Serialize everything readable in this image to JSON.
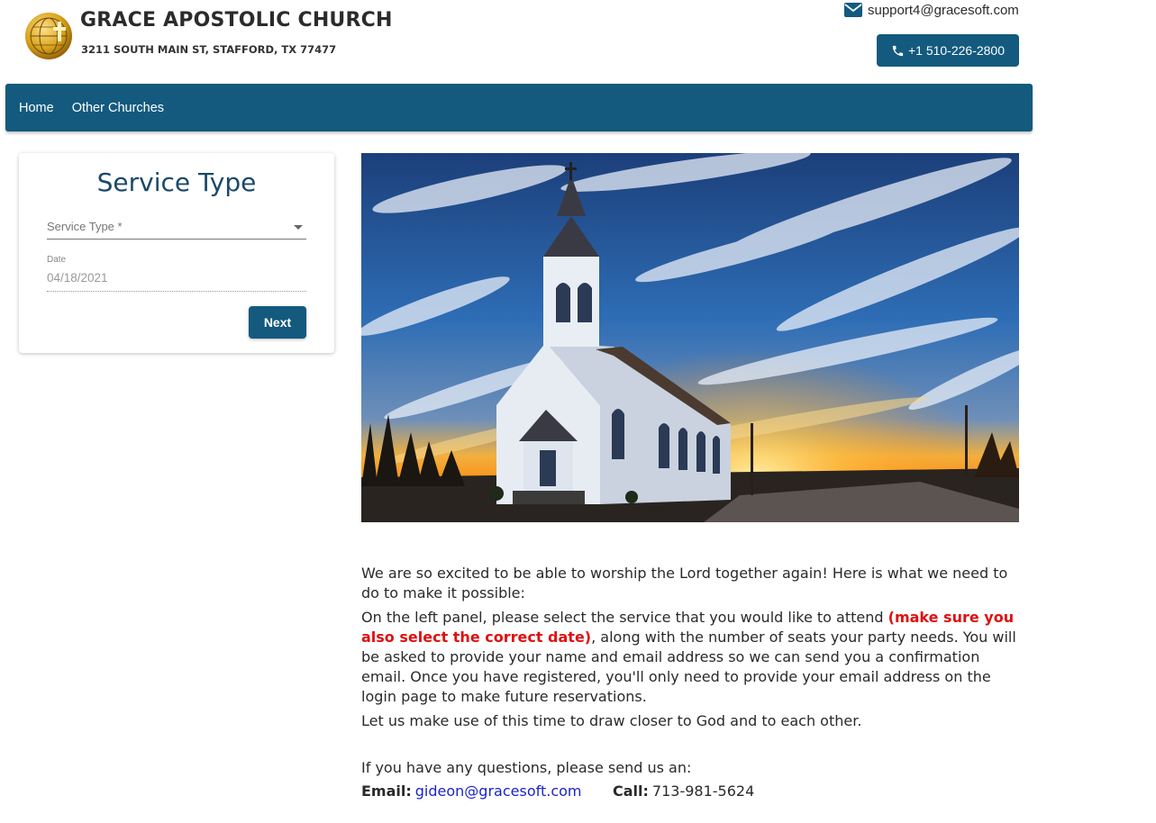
{
  "header": {
    "church_name": "GRACE APOSTOLIC CHURCH",
    "address": "3211 SOUTH MAIN ST, STAFFORD, TX 77477",
    "support_email": "support4@gracesoft.com",
    "phone_button": "+1 510-226-2800",
    "icons": {
      "logo": "globe-cross-logo",
      "email": "mail-icon",
      "phone": "phone-icon"
    }
  },
  "nav": {
    "items": [
      {
        "label": "Home"
      },
      {
        "label": "Other Churches"
      }
    ]
  },
  "service_card": {
    "title": "Service Type",
    "select_label": "Service Type *",
    "date_label": "Date",
    "date_value": "04/18/2021",
    "next_button": "Next"
  },
  "content": {
    "intro": "We are so excited to be able to worship the Lord together again! Here is what we need to do to make it possible:",
    "instructions_pre": "On the left panel, please select the service that you would like to attend ",
    "instructions_highlight": "(make sure you also select the correct date)",
    "instructions_post": ", along with the number of seats your party needs. You will be asked to provide your name and email address so we can send you a confirmation email. Once you have registered, you'll only need to provide your email address on the login page to make future reservations.",
    "closing": "Let us make use of this time to draw closer to God and to each other.",
    "questions": "If you have any questions, please send us an:",
    "email_label": "Email:",
    "email_value": "gideon@gracesoft.com",
    "call_label": "Call:",
    "call_value": "713-981-5624"
  },
  "colors": {
    "primary": "#135a7e",
    "title_blue": "#1a4a68",
    "highlight_red": "#e01010",
    "link_blue": "#1a24c9"
  }
}
